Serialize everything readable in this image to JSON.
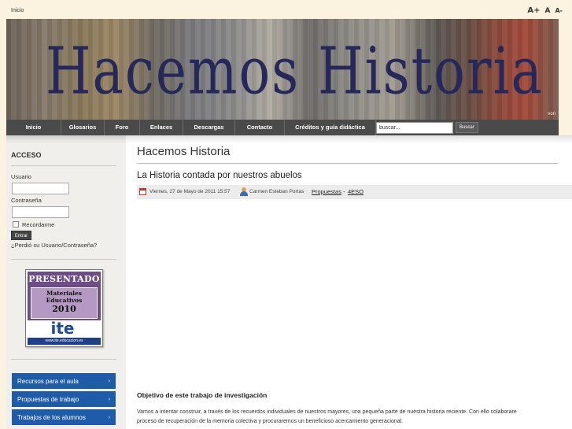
{
  "breadcrumb": "Inicio",
  "font_controls": {
    "increase": "A+",
    "reset": "A",
    "decrease": "A-"
  },
  "banner": {
    "title": "Hacemos Historia",
    "tag": "von"
  },
  "nav": {
    "items": [
      "Inicio",
      "Glosarios",
      "Foro",
      "Enlaces",
      "Descargas",
      "Contacto",
      "Créditos y guía didáctica"
    ],
    "search_placeholder": "buscar...",
    "search_button": "Buscar"
  },
  "login": {
    "heading": "ACCESO",
    "user_label": "Usuario",
    "password_label": "Contraseña",
    "remember_label": "Recordarme",
    "enter_button": "Entrar",
    "forgot_link": "¿Perdió su Usuario/Contraseña?"
  },
  "badge": {
    "presentado": "PRESENTADO",
    "line1": "Materiales",
    "line2": "Educativos",
    "year": "2010",
    "logo": "ite",
    "url": "www.ite.educacion.es"
  },
  "side_menu": [
    {
      "label": "Recursos para el aula"
    },
    {
      "label": "Propuestas de trabajo"
    },
    {
      "label": "Trabajos de los alumnos"
    }
  ],
  "main": {
    "page_title": "Hacemos Historia",
    "article_title": "La Historia contada por nuestros abuelos",
    "meta": {
      "date": "Viernes, 27 de Mayo de 2011 15:57",
      "author": "Carmen Esteban Portas",
      "category": "Propuestas",
      "separator": "-",
      "subcategory": "4ESO"
    },
    "section_title": "Objetivo de este trabajo de investigación",
    "paragraph_line1": "Vamos a intentar construir, a través de los recuerdos individuales de nuestros mayores, una pequeña parte de nuestra historia reciente. Con ello colaborare",
    "paragraph_line2": "proceso de recuperación de la memoria colectiva y procuraremos un beneficioso acercamiento generacional."
  }
}
